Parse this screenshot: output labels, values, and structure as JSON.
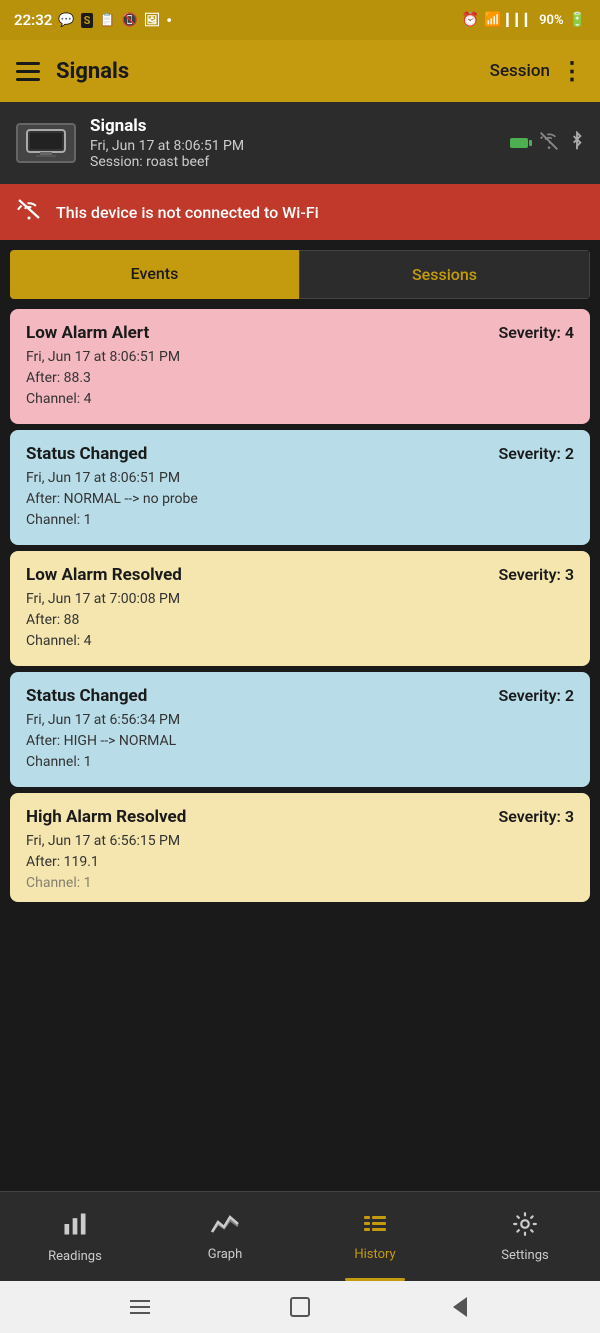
{
  "statusBar": {
    "time": "22:32",
    "battery": "90%"
  },
  "appBar": {
    "title": "Signals",
    "sessionLabel": "Session",
    "menuIcon": "⋮"
  },
  "deviceInfo": {
    "name": "Signals",
    "datetime": "Fri, Jun 17  at 8:06:51 PM",
    "session": "Session: roast beef"
  },
  "wifiWarning": {
    "text": "This device is not connected to Wi-Fi"
  },
  "tabs": [
    {
      "label": "Events",
      "active": true
    },
    {
      "label": "Sessions",
      "active": false
    }
  ],
  "events": [
    {
      "title": "Low Alarm Alert",
      "severity": "Severity: 4",
      "datetime": "Fri, Jun 17  at 8:06:51 PM",
      "after": "After: 88.3",
      "channel": "Channel:  4",
      "color": "pink"
    },
    {
      "title": "Status Changed",
      "severity": "Severity: 2",
      "datetime": "Fri, Jun 17  at 8:06:51 PM",
      "after": "After: NORMAL --> no probe",
      "channel": "Channel:  1",
      "color": "blue"
    },
    {
      "title": "Low Alarm Resolved",
      "severity": "Severity: 3",
      "datetime": "Fri, Jun 17  at 7:00:08 PM",
      "after": "After: 88",
      "channel": "Channel:  4",
      "color": "yellow"
    },
    {
      "title": "Status Changed",
      "severity": "Severity: 2",
      "datetime": "Fri, Jun 17  at 6:56:34 PM",
      "after": "After: HIGH --> NORMAL",
      "channel": "Channel:  1",
      "color": "blue"
    },
    {
      "title": "High Alarm Resolved",
      "severity": "Severity: 3",
      "datetime": "Fri, Jun 17  at 6:56:15 PM",
      "after": "After: 119.1",
      "channel": "Channel:  1",
      "color": "yellow"
    }
  ],
  "bottomNav": [
    {
      "label": "Readings",
      "icon": "bar",
      "active": false
    },
    {
      "label": "Graph",
      "icon": "graph",
      "active": false
    },
    {
      "label": "History",
      "icon": "list",
      "active": true
    },
    {
      "label": "Settings",
      "icon": "gear",
      "active": false
    }
  ]
}
